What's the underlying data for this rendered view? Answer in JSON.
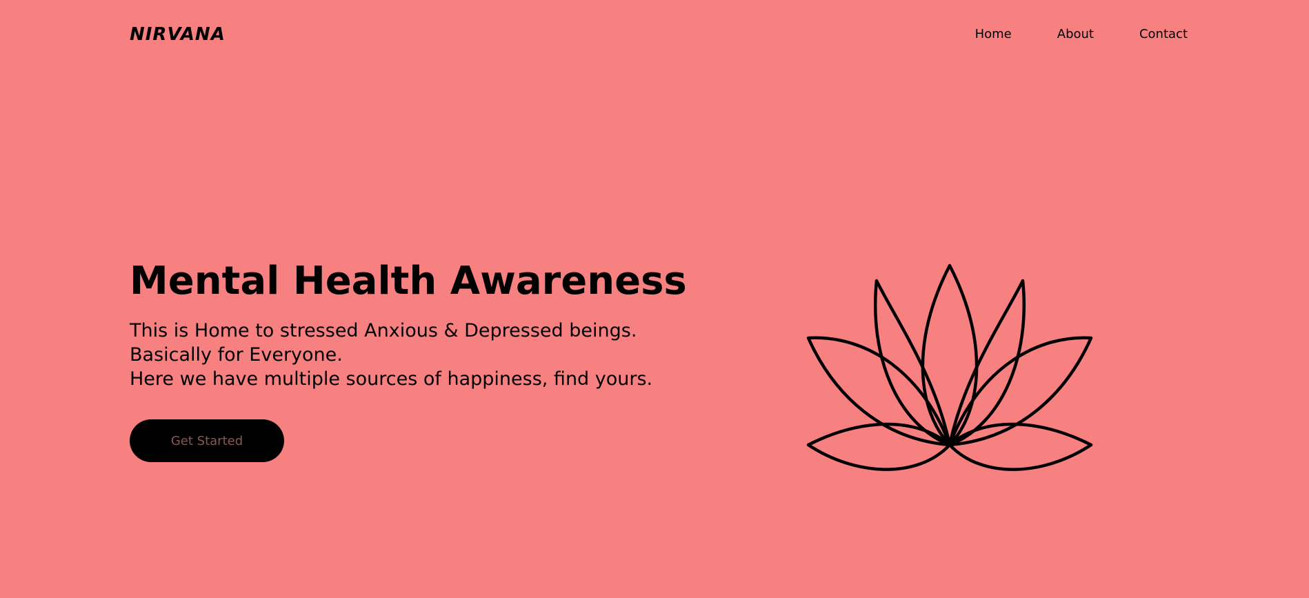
{
  "nav": {
    "logo": "NIRVANA",
    "links": [
      "Home",
      "About",
      "Contact"
    ]
  },
  "hero": {
    "title": "Mental Health Awareness",
    "lines": [
      "This is Home to stressed Anxious & Depressed beings.",
      "Basically for Everyone.",
      "Here we have multiple sources of happiness, find yours."
    ],
    "cta_label": "Get Started"
  },
  "illustration": {
    "icon": "lotus-icon",
    "stroke_color": "#000000"
  },
  "colors": {
    "background": "#f78080",
    "button_bg": "#000000",
    "button_text": "#8a5757"
  }
}
